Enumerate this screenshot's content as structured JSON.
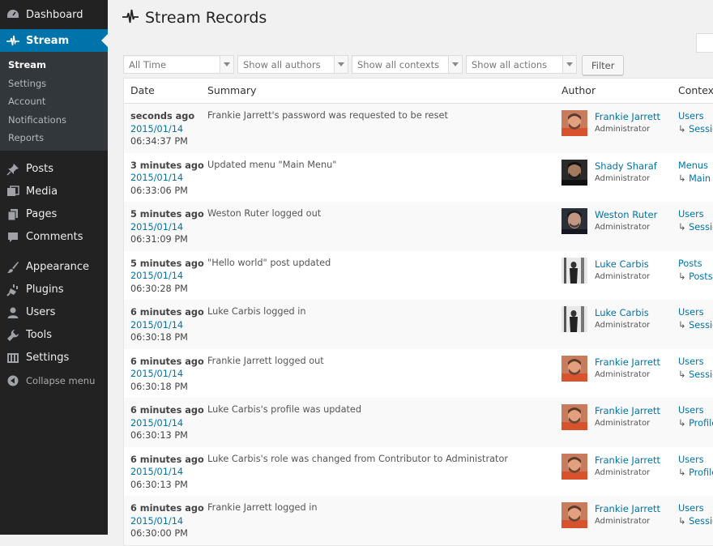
{
  "sidebar": {
    "dashboard": "Dashboard",
    "stream": "Stream",
    "stream_sub": [
      "Stream",
      "Settings",
      "Account",
      "Notifications",
      "Reports"
    ],
    "posts": "Posts",
    "media": "Media",
    "pages": "Pages",
    "comments": "Comments",
    "appearance": "Appearance",
    "plugins": "Plugins",
    "users": "Users",
    "tools": "Tools",
    "settings": "Settings",
    "collapse": "Collapse menu"
  },
  "page": {
    "title": "Stream Records"
  },
  "filters": {
    "date": "All Time",
    "authors": "Show all authors",
    "contexts": "Show all contexts",
    "actions": "Show all actions",
    "filter_button": "Filter"
  },
  "table": {
    "headers": {
      "date": "Date",
      "summary": "Summary",
      "author": "Author",
      "context": "Context"
    },
    "rows": [
      {
        "ago": "seconds ago",
        "date": "2015/01/14",
        "time": "06:34:37 PM",
        "summary": "Frankie Jarrett's password was requested to be reset",
        "author": "Frankie Jarrett",
        "role": "Administrator",
        "context": "Users",
        "subcontext": "Sessions",
        "avatar": "frankie"
      },
      {
        "ago": "3 minutes ago",
        "date": "2015/01/14",
        "time": "06:33:06 PM",
        "summary": "Updated menu \"Main Menu\"",
        "author": "Shady Sharaf",
        "role": "Administrator",
        "context": "Menus",
        "subcontext": "Main Menu",
        "avatar": "shady"
      },
      {
        "ago": "5 minutes ago",
        "date": "2015/01/14",
        "time": "06:31:09 PM",
        "summary": "Weston Ruter logged out",
        "author": "Weston Ruter",
        "role": "Administrator",
        "context": "Users",
        "subcontext": "Sessions",
        "avatar": "weston"
      },
      {
        "ago": "5 minutes ago",
        "date": "2015/01/14",
        "time": "06:30:28 PM",
        "summary": "\"Hello world\" post updated",
        "author": "Luke Carbis",
        "role": "Administrator",
        "context": "Posts",
        "subcontext": "Posts",
        "avatar": "luke"
      },
      {
        "ago": "6 minutes ago",
        "date": "2015/01/14",
        "time": "06:30:18 PM",
        "summary": "Luke Carbis logged in",
        "author": "Luke Carbis",
        "role": "Administrator",
        "context": "Users",
        "subcontext": "Sessions",
        "avatar": "luke"
      },
      {
        "ago": "6 minutes ago",
        "date": "2015/01/14",
        "time": "06:30:18 PM",
        "summary": "Frankie Jarrett logged out",
        "author": "Frankie Jarrett",
        "role": "Administrator",
        "context": "Users",
        "subcontext": "Sessions",
        "avatar": "frankie"
      },
      {
        "ago": "6 minutes ago",
        "date": "2015/01/14",
        "time": "06:30:13 PM",
        "summary": "Luke Carbis's profile was updated",
        "author": "Frankie Jarrett",
        "role": "Administrator",
        "context": "Users",
        "subcontext": "Profiles",
        "avatar": "frankie"
      },
      {
        "ago": "6 minutes ago",
        "date": "2015/01/14",
        "time": "06:30:13 PM",
        "summary": "Luke Carbis's role was changed from Contributor to Administrator",
        "author": "Frankie Jarrett",
        "role": "Administrator",
        "context": "Users",
        "subcontext": "Profiles",
        "avatar": "frankie"
      },
      {
        "ago": "6 minutes ago",
        "date": "2015/01/14",
        "time": "06:30:00 PM",
        "summary": "Frankie Jarrett logged in",
        "author": "Frankie Jarrett",
        "role": "Administrator",
        "context": "Users",
        "subcontext": "Sessions",
        "avatar": "frankie"
      }
    ]
  },
  "colors": {
    "accent": "#0073aa",
    "sidebar_bg": "#222222",
    "submenu_bg": "#32373c",
    "page_bg": "#f1f1f1"
  }
}
